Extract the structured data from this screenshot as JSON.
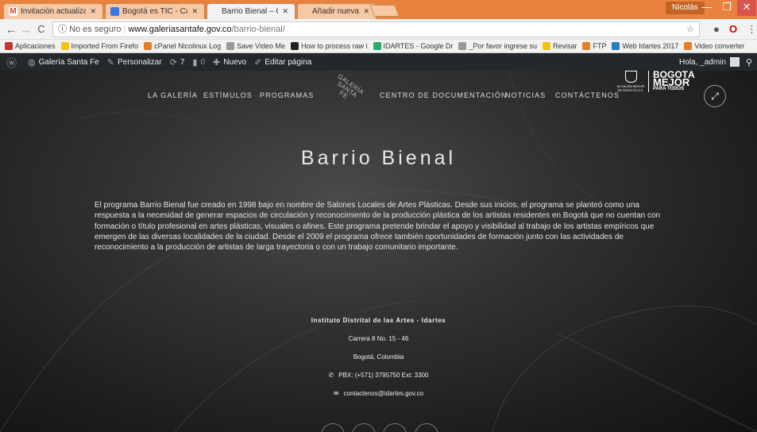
{
  "tabs": [
    {
      "title": "Invitación actualizada: Co",
      "favicon": "gmail-icon",
      "active": false
    },
    {
      "title": "Bogotá es TIC - Calendar",
      "favicon": "calendar-icon",
      "active": false
    },
    {
      "title": "Barrio Bienal – Galeria Sa",
      "favicon": "page-icon",
      "active": true
    },
    {
      "title": "Añadir nueva página ‹ Ga",
      "favicon": "wordpress-icon",
      "active": false
    }
  ],
  "window": {
    "profile": "Nicolás",
    "minimize": "—",
    "maximize": "❐",
    "close": "✕"
  },
  "address": {
    "security": "No es seguro",
    "domain": "www.galeriasantafe.gov.co",
    "path": "/barrio-bienal/"
  },
  "bookmarks": [
    {
      "label": "Aplicaciones",
      "color": "#c0392b"
    },
    {
      "label": "Imported From Firefo",
      "color": "#f1c40f"
    },
    {
      "label": "cPanel Nicolinux Log",
      "color": "#e67e22"
    },
    {
      "label": "Save Video Me",
      "color": "#999999"
    },
    {
      "label": "How to process raw i",
      "color": "#222222"
    },
    {
      "label": "IDARTES - Google Dr",
      "color": "#27ae60"
    },
    {
      "label": "_Por favor ingrese su",
      "color": "#999999"
    },
    {
      "label": "Revisar",
      "color": "#f1c40f"
    },
    {
      "label": "FTP",
      "color": "#e67e22"
    },
    {
      "label": "Web Idartes 2017",
      "color": "#2980b9"
    },
    {
      "label": "Video converter",
      "color": "#e67e22"
    }
  ],
  "adminbar": {
    "site": "Galería Santa Fe",
    "customize": "Personalizar",
    "updates": "7",
    "comments": "0",
    "new": "Nuevo",
    "edit": "Editar página",
    "greeting": "Hola, _admin"
  },
  "nav": {
    "items": [
      "LA GALERÍA",
      "ESTÍMULOS",
      "PROGRAMAS",
      "CENTRO DE DOCUMENTACIÓN",
      "NOTICIAS",
      "CONTÁCTENOS"
    ],
    "logo_lines": [
      "GALERÍA",
      "SANTA",
      "FE"
    ],
    "alcaldia": "ALCALDÍA MAYOR DE BOGOTÁ D.C.",
    "bogota": [
      "BOGOTÁ",
      "MEJOR",
      "PARA TODOS"
    ]
  },
  "page": {
    "title": "Barrio Bienal",
    "intro": "El programa Barrio Bienal fue creado en 1998 bajo en nombre de Salones Locales de Artes Plásticas. Desde sus inicios, el programa se planteó como una respuesta a la necesidad de generar espacios de circulación y reconocimiento de la producción plástica de los artistas residentes en Bogotá que no cuentan con formación o título profesional en artes plásticas, visuales o afines. Este programa pretende brindar el apoyo y visibilidad al trabajo de los artistas empíricos que emergen de las diversas localidades de la ciudad. Desde el 2009 el programa ofrece también oportunidades de formación junto con las actividades de reconocimiento a la producción de artistas de larga trayectoria o con un trabajo comunitario importante."
  },
  "footer": {
    "org": "Instituto Distrital de las Artes - Idartes",
    "address": "Carrera 8 No. 15 - 46",
    "city": "Bogotá, Colombia",
    "phone": "PBX: (+571) 3795750 Ext: 3300",
    "email": "contactenos@idartes.gov.co"
  }
}
